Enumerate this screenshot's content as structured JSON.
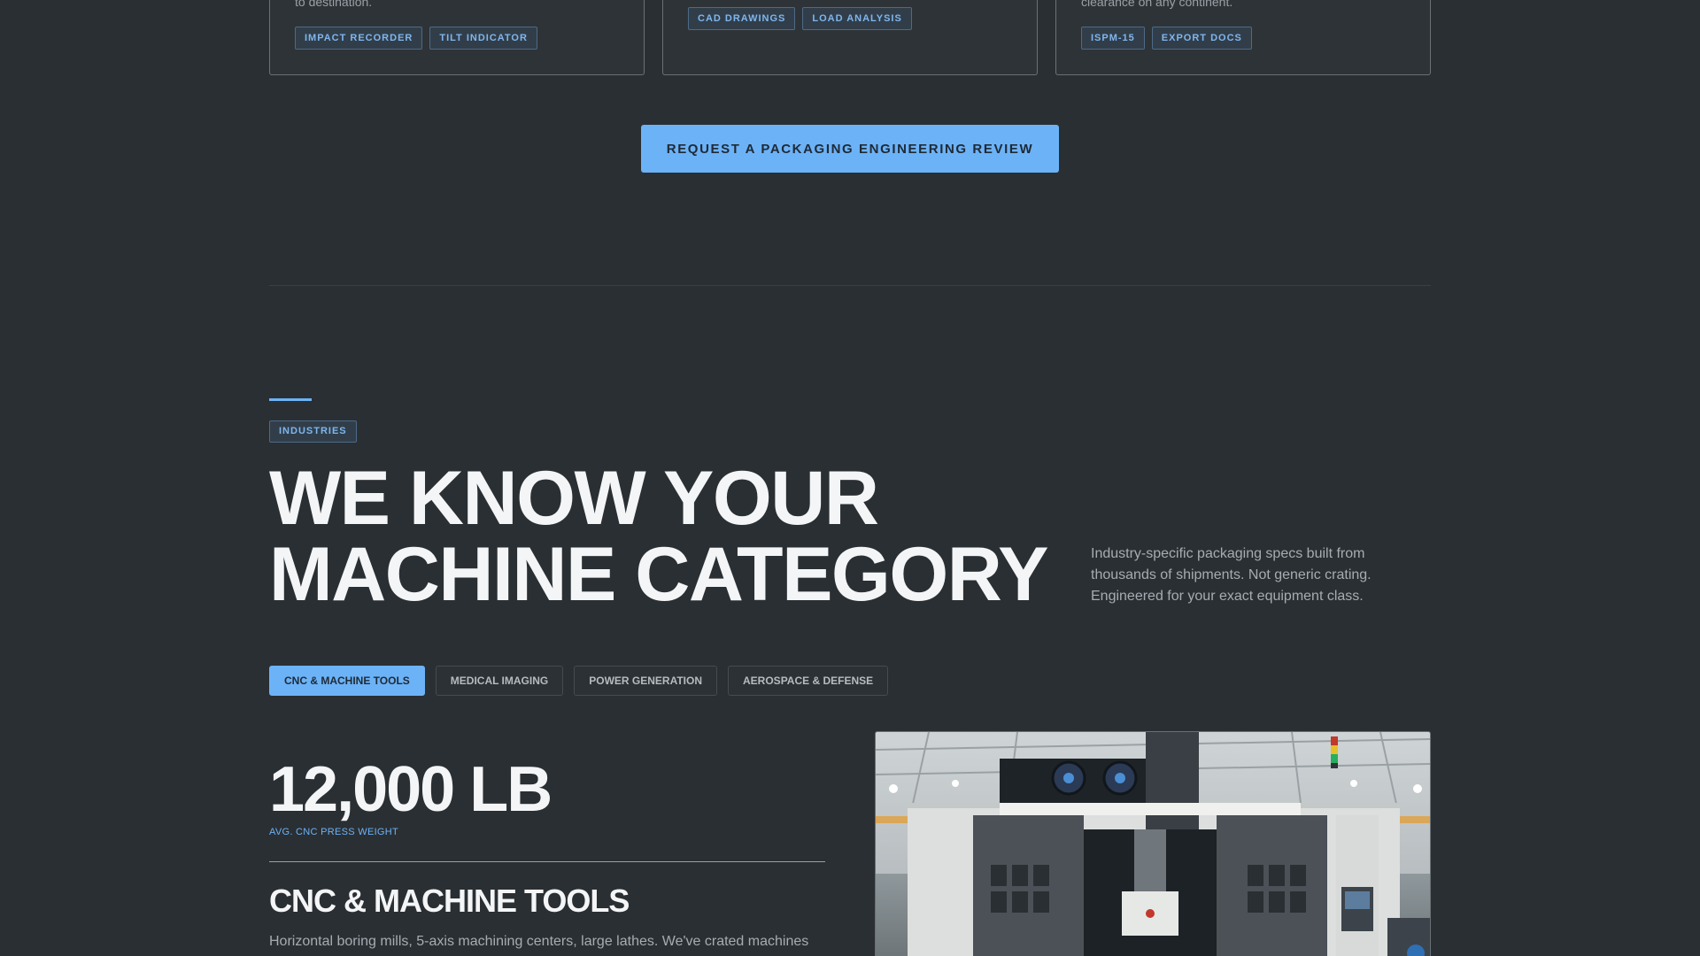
{
  "cards": [
    {
      "text": "to destination.",
      "tags": [
        "IMPACT RECORDER",
        "TILT INDICATOR"
      ]
    },
    {
      "text": "",
      "tags": [
        "CAD DRAWINGS",
        "LOAD ANALYSIS"
      ]
    },
    {
      "text": "clearance on any continent.",
      "tags": [
        "ISPM-15",
        "EXPORT DOCS"
      ]
    }
  ],
  "cta_label": "REQUEST A PACKAGING ENGINEERING REVIEW",
  "industries": {
    "eyebrow": "INDUSTRIES",
    "headline_line1": "WE KNOW YOUR",
    "headline_line2": "MACHINE CATEGORY",
    "intro": "Industry-specific packaging specs built from thousands of shipments. Not generic crating. Engineered for your exact equipment class.",
    "tabs": [
      {
        "label": "CNC & MACHINE TOOLS",
        "active": true
      },
      {
        "label": "MEDICAL IMAGING",
        "active": false
      },
      {
        "label": "POWER GENERATION",
        "active": false
      },
      {
        "label": "AEROSPACE & DEFENSE",
        "active": false
      }
    ],
    "stat_value": "12,000 LB",
    "stat_label": "AVG. CNC PRESS WEIGHT",
    "panel_title": "CNC & MACHINE TOOLS",
    "panel_text": "Horizontal boring mills, 5-axis machining centers, large lathes. We've crated machines"
  },
  "colors": {
    "background": "#2a2f33",
    "accent": "#6cb2f7",
    "tag_text": "#7fb6ee"
  }
}
